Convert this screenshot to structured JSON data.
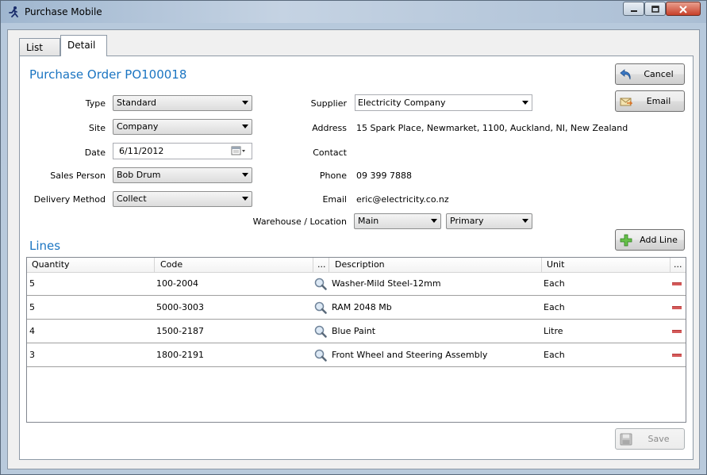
{
  "window": {
    "title": "Purchase Mobile",
    "icon": "running-figure-icon",
    "controls": [
      "min",
      "max",
      "close"
    ]
  },
  "tabs": [
    {
      "label": "List"
    },
    {
      "label": "Detail"
    }
  ],
  "order": {
    "heading": "Purchase Order PO100018",
    "type_label": "Type",
    "type_value": "Standard",
    "site_label": "Site",
    "site_value": "Company",
    "date_label": "Date",
    "date_value": "6/11/2012",
    "sales_person_label": "Sales Person",
    "sales_person_value": "Bob Drum",
    "delivery_label": "Delivery Method",
    "delivery_value": "Collect",
    "supplier_label": "Supplier",
    "supplier_value": "Electricity Company",
    "address_label": "Address",
    "address_value": "15 Spark Place, Newmarket, 1100, Auckland, NI, New Zealand",
    "contact_label": "Contact",
    "contact_value": "",
    "phone_label": "Phone",
    "phone_value": "09 399 7888",
    "email_label": "Email",
    "email_value": "eric@electricity.co.nz",
    "warehouse_label": "Warehouse / Location",
    "warehouse_value": "Main",
    "location_value": "Primary"
  },
  "buttons": {
    "cancel": "Cancel",
    "email": "Email",
    "add_line": "Add Line",
    "save": "Save"
  },
  "lines": {
    "heading": "Lines",
    "columns": [
      "Quantity",
      "Code",
      "...",
      "Description",
      "Unit",
      "..."
    ],
    "rows": [
      {
        "quantity": "5",
        "code": "100-2004",
        "description": "Washer-Mild Steel-12mm",
        "unit": "Each"
      },
      {
        "quantity": "5",
        "code": "5000-3003",
        "description": "RAM 2048 Mb",
        "unit": "Each"
      },
      {
        "quantity": "4",
        "code": "1500-2187",
        "description": "Blue Paint",
        "unit": "Litre"
      },
      {
        "quantity": "3",
        "code": "1800-2191",
        "description": "Front Wheel and Steering Assembly",
        "unit": "Each"
      }
    ]
  },
  "colors": {
    "accent": "#1b75c2",
    "remove": "#d45a5a"
  }
}
